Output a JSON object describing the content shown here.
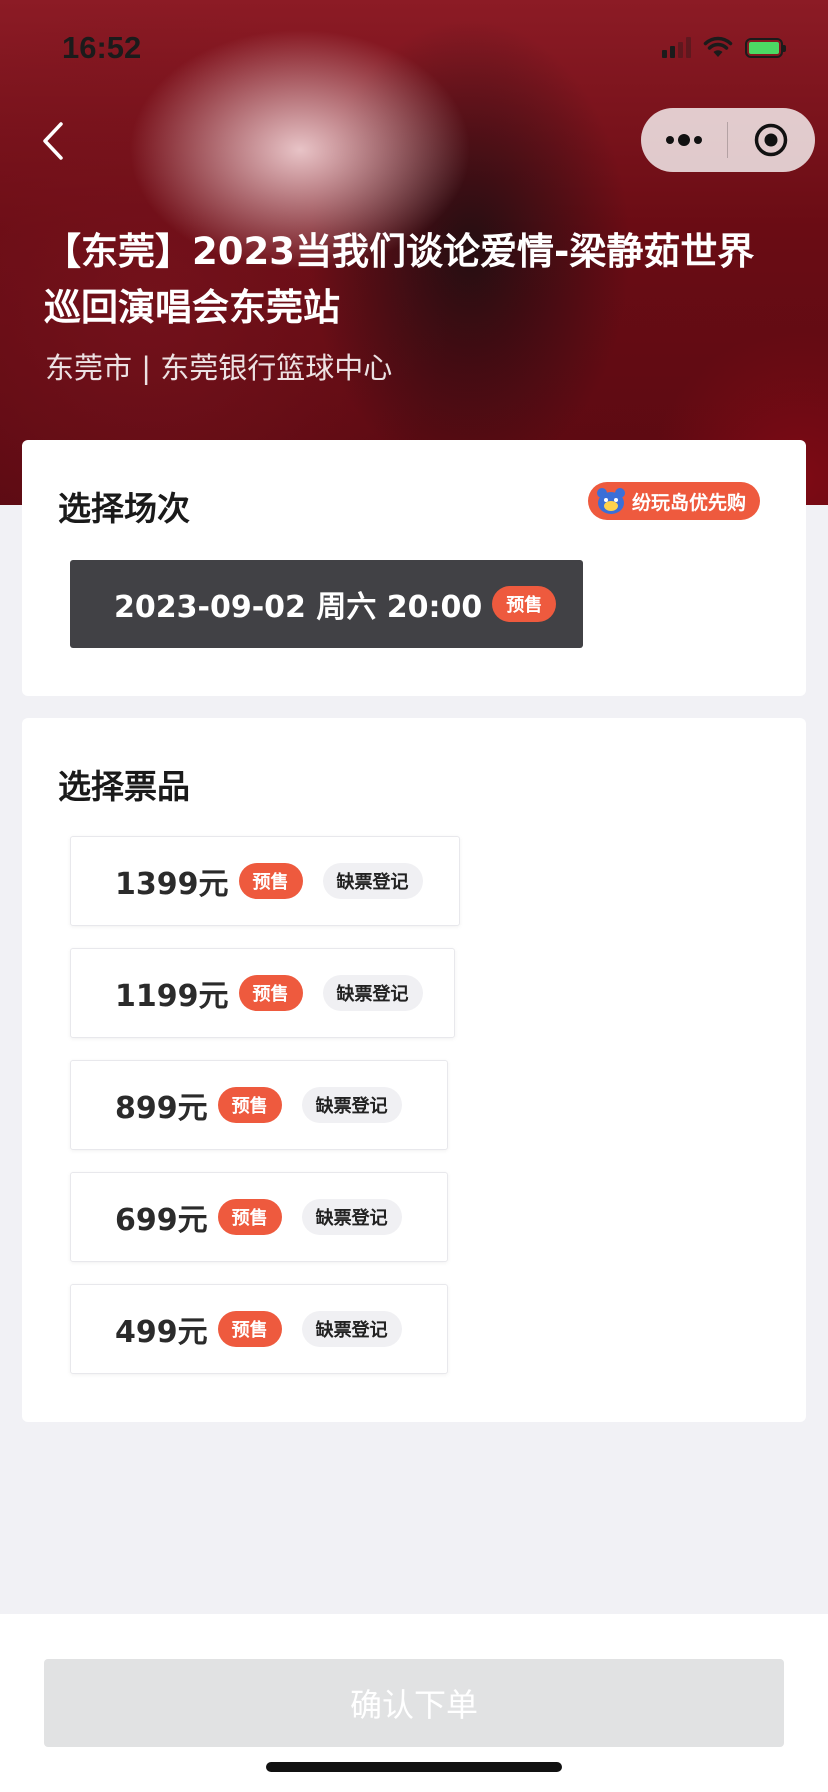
{
  "status_bar": {
    "time": "16:52"
  },
  "header": {
    "event_title": "【东莞】2023当我们谈论爱情-梁静茹世界巡回演唱会东莞站",
    "venue": "东莞市 | 东莞银行篮球中心"
  },
  "session": {
    "title": "选择场次",
    "promo_tag": "纷玩岛优先购",
    "options": [
      {
        "label": "2023-09-02 周六 20:00",
        "badge": "预售"
      }
    ]
  },
  "tickets": {
    "title": "选择票品",
    "items": [
      {
        "price": "1399元",
        "badge": "预售",
        "waitlist": "缺票登记"
      },
      {
        "price": "1199元",
        "badge": "预售",
        "waitlist": "缺票登记"
      },
      {
        "price": "899元",
        "badge": "预售",
        "waitlist": "缺票登记"
      },
      {
        "price": "699元",
        "badge": "预售",
        "waitlist": "缺票登记"
      },
      {
        "price": "499元",
        "badge": "预售",
        "waitlist": "缺票登记"
      }
    ]
  },
  "footer": {
    "confirm_label": "确认下单"
  },
  "colors": {
    "accent": "#ee5a3e",
    "session_selected": "#414145",
    "disabled_button": "#e1e2e3"
  },
  "icons": [
    "back-arrow-icon",
    "more-dots-icon",
    "close-target-icon",
    "bear-icon",
    "signal-icon",
    "wifi-icon",
    "battery-icon"
  ]
}
